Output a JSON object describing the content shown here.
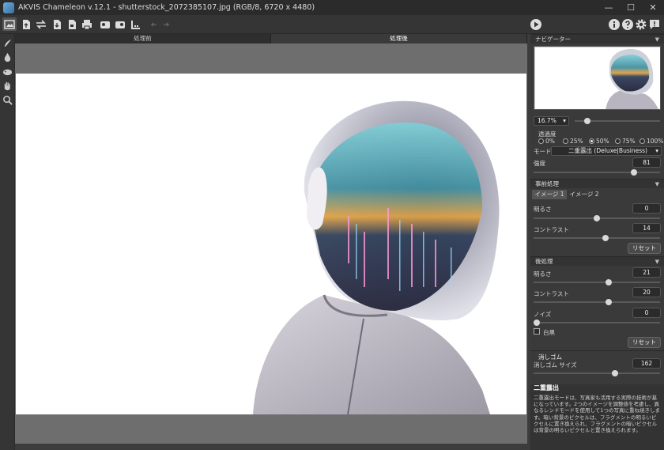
{
  "window": {
    "title": "AKVIS Chameleon v.12.1 - shutterstock_2072385107.jpg (RGB/8, 6720 x 4480)",
    "controls": {
      "minimize": "—",
      "maximize": "☐",
      "close": "✕"
    }
  },
  "canvas_tabs": [
    {
      "label": "処理前",
      "active": false
    },
    {
      "label": "処理後",
      "active": true
    }
  ],
  "toolbar": {
    "icons": [
      "home-icon",
      "open-icon",
      "swap-icon",
      "save-icon",
      "export-icon",
      "print-icon",
      "layers-icon",
      "collage-icon",
      "chameleon-icon",
      "undo-icon",
      "redo-icon",
      "run-icon",
      "info-icon",
      "help-icon",
      "settings-icon",
      "news-icon"
    ]
  },
  "left_tools": [
    "brush-icon",
    "drop-icon",
    "chameleon-tool-icon",
    "hand-icon",
    "zoom-icon"
  ],
  "navigator": {
    "header": "ナビゲーター",
    "zoom": "16.7%",
    "zoom_level": 0.12
  },
  "transparency": {
    "label": "透過度",
    "options": [
      "0%",
      "25%",
      "50%",
      "75%",
      "100%"
    ],
    "selected": "50%"
  },
  "mode": {
    "label": "モード",
    "value": "二重露出 (Deluxe|Business)"
  },
  "strength": {
    "label": "強度",
    "value": "81",
    "level": 0.81
  },
  "preprocess": {
    "header": "事前処理",
    "tabs": [
      "イメージ 1",
      "イメージ 2"
    ],
    "brightness": {
      "label": "明るさ",
      "value": "0",
      "level": 0.5
    },
    "contrast": {
      "label": "コントラスト",
      "value": "14",
      "level": 0.57
    },
    "reset": "リセット"
  },
  "postprocess": {
    "header": "後処理",
    "brightness": {
      "label": "明るさ",
      "value": "21",
      "level": 0.6
    },
    "contrast": {
      "label": "コントラスト",
      "value": "20",
      "level": 0.6
    },
    "noise": {
      "label": "ノイズ",
      "value": "0",
      "level": 0.0
    },
    "bw_label": "白黒",
    "reset": "リセット"
  },
  "eraser": {
    "header": "消しゴム",
    "size": {
      "label": "消しゴム サイズ",
      "value": "162",
      "level": 0.65
    }
  },
  "help": {
    "title": "二重露出",
    "text": "二重露出モードは、写真家も活用する実際の技術が基になっています。2つのイメージを調整値を考慮し、異なるレンドモードを使用して1つの写真に重ね焼きします。暗い背景のピクセルは、フラグメントの明るいピクセルに置き換えられ、フラグメントの暗いピクセルは背景の明るいピクセルと置き換えられます。"
  }
}
